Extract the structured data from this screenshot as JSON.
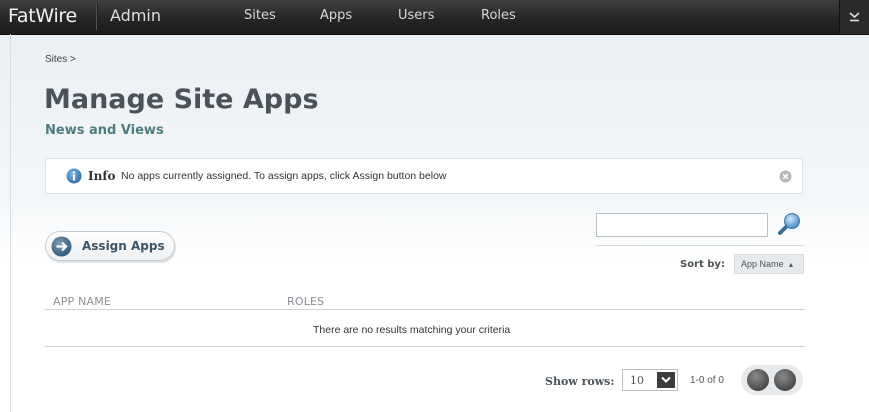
{
  "topbar": {
    "brand": "FatWire",
    "section": "Admin",
    "nav": [
      {
        "label": "Sites"
      },
      {
        "label": "Apps"
      },
      {
        "label": "Users"
      },
      {
        "label": "Roles"
      }
    ],
    "menu_icon": "chevron-down-icon"
  },
  "breadcrumb": "Sites >",
  "page": {
    "title": "Manage Site Apps",
    "subtitle": "News and Views"
  },
  "info": {
    "title": "Info",
    "message": "No apps currently assigned. To assign apps, click Assign button below",
    "icon": "info-icon",
    "close_icon": "close-icon"
  },
  "actions": {
    "assign_label": "Assign Apps"
  },
  "search": {
    "value": "",
    "placeholder": ""
  },
  "sort": {
    "label": "Sort by:",
    "value": "App Name"
  },
  "table": {
    "columns": [
      "APP NAME",
      "ROLES"
    ],
    "empty_message": "There are no results matching your criteria"
  },
  "pagination": {
    "rows_label": "Show rows:",
    "rows_value": "10",
    "range_text": "1-0 of 0"
  },
  "colors": {
    "topbar": "#262626",
    "title": "#4b5358",
    "subtitle": "#4e7d80",
    "accent": "#3d6f9e"
  }
}
